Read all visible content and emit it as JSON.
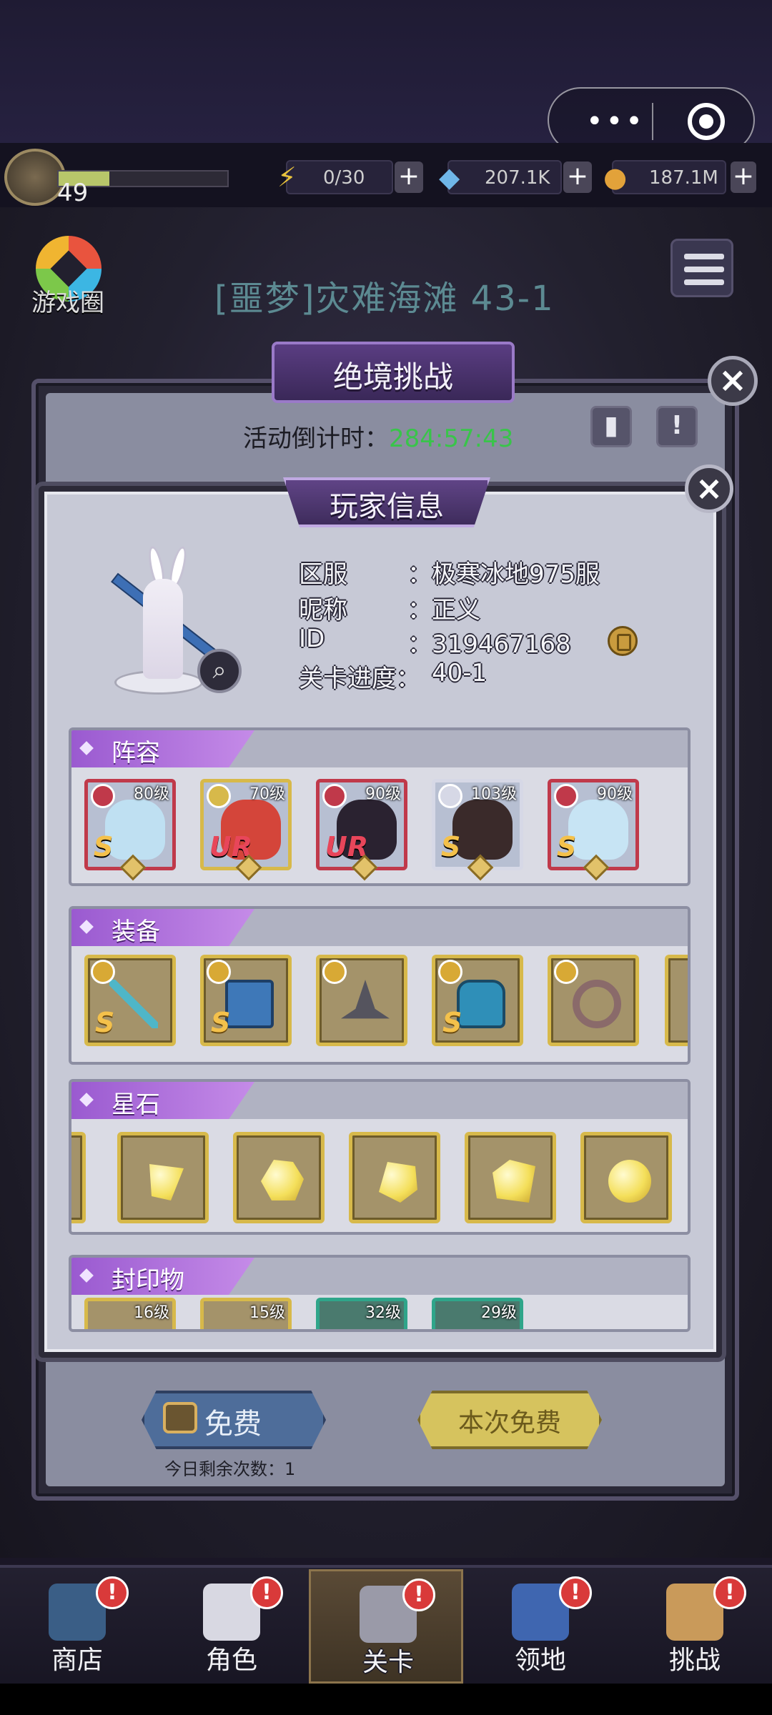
{
  "top_capsule": {
    "more_icon": "more-dots-icon",
    "close_icon": "target-circle-icon"
  },
  "resources": {
    "player_level": "49",
    "stamina": "0/30",
    "diamond": "207.1K",
    "gold": "187.1M"
  },
  "scene": {
    "game_circle_label": "游戏圈",
    "stage_title": "[噩梦]灾难海滩 43-1"
  },
  "challenge_dialog": {
    "title": "绝境挑战",
    "countdown_label": "活动倒计时：",
    "countdown_value": "284:57:43",
    "free_button": "免费",
    "free_note": "今日剩余次数：1",
    "free_this_time": "本次免费"
  },
  "player_dialog": {
    "title": "玩家信息",
    "server_label": "区服",
    "server_value": "：极寒冰地975服",
    "nickname_label": "昵称",
    "nickname_value": "：正义",
    "id_label": "ID",
    "id_value": "：319467168",
    "progress_label": "关卡进度：",
    "progress_value": "40-1",
    "sections": {
      "lineup": "阵容",
      "equipment": "装备",
      "starstone": "星石",
      "seal": "封印物"
    },
    "lineup": [
      {
        "level": "80级",
        "rank": "S",
        "frame": "#c0394a",
        "face": "#bfe0f2",
        "rank_color": "#f4c14b"
      },
      {
        "level": "70级",
        "rank": "UR",
        "frame": "#d7b94a",
        "face": "#d4453a",
        "rank_color": "#e8465a"
      },
      {
        "level": "90级",
        "rank": "UR",
        "frame": "#c0394a",
        "face": "#2a2230",
        "rank_color": "#e8465a"
      },
      {
        "level": "103级",
        "rank": "S",
        "frame": "#d6d8e6",
        "face": "#3a2a2a",
        "rank_color": "#f4c14b"
      },
      {
        "level": "90级",
        "rank": "S",
        "frame": "#c0394a",
        "face": "#c7e4f4",
        "rank_color": "#f4c14b"
      }
    ],
    "equipment": [
      {
        "name": "trident-icon",
        "rank": "S"
      },
      {
        "name": "spellbook-icon",
        "rank": "S"
      },
      {
        "name": "wizard-hat-icon",
        "rank": ""
      },
      {
        "name": "armor-icon",
        "rank": "S"
      },
      {
        "name": "ring-icon",
        "rank": ""
      }
    ],
    "seals": [
      {
        "level": "16级",
        "color": "gold"
      },
      {
        "level": "15级",
        "color": "gold"
      },
      {
        "level": "32级",
        "color": "green"
      },
      {
        "level": "29级",
        "color": "green"
      }
    ]
  },
  "nav": [
    {
      "label": "商店",
      "icon": "shop-icon",
      "active": false
    },
    {
      "label": "角色",
      "icon": "character-icon",
      "active": false
    },
    {
      "label": "关卡",
      "icon": "crossed-swords-icon",
      "active": true
    },
    {
      "label": "领地",
      "icon": "castle-icon",
      "active": false
    },
    {
      "label": "挑战",
      "icon": "scroll-map-icon",
      "active": false
    }
  ],
  "nav_badge": "!"
}
